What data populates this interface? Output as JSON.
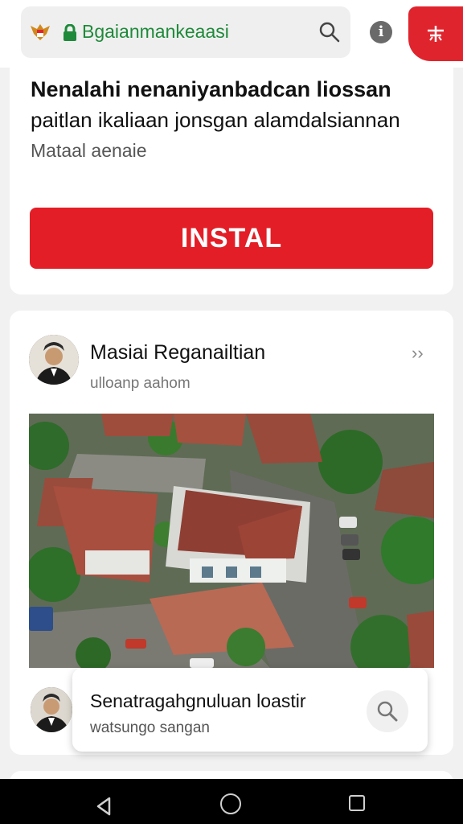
{
  "browser": {
    "url": "Bgaianmankeaasi"
  },
  "card1": {
    "title": "Nenalahi nenaniyanbadcan liossan",
    "subtitle": "paitlan ikaliaan jonsgan alamdalsiannan",
    "meta": "Mataal aenaie",
    "install_label": "INSTAL"
  },
  "card2": {
    "name": "Masiai Reganailtian",
    "handle": "ulloanp aahom",
    "chevron": "››"
  },
  "suggestion": {
    "title": "Senatragahgnuluan loastir",
    "subtitle": "watsungo sangan"
  },
  "colors": {
    "accent_red": "#e31e26",
    "url_green": "#1e8a3a"
  }
}
